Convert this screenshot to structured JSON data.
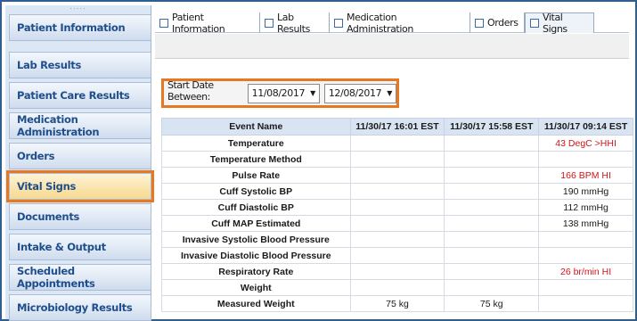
{
  "sidebar": {
    "items": [
      {
        "label": "Patient Information",
        "active": false
      },
      {
        "label": "Lab Results",
        "active": false
      },
      {
        "label": "Patient Care Results",
        "active": false
      },
      {
        "label": "Medication Administration",
        "active": false
      },
      {
        "label": "Orders",
        "active": false
      },
      {
        "label": "Vital Signs",
        "active": true
      },
      {
        "label": "Documents",
        "active": false
      },
      {
        "label": "Intake & Output",
        "active": false
      },
      {
        "label": "Scheduled Appointments",
        "active": false
      },
      {
        "label": "Microbiology Results",
        "active": false
      }
    ]
  },
  "tabs": [
    {
      "label": "Patient Information",
      "icon": "page-icon"
    },
    {
      "label": "Lab Results",
      "icon": "page-icon"
    },
    {
      "label": "Medication Administration",
      "icon": "page-icon"
    },
    {
      "label": "Orders",
      "icon": "page-icon"
    },
    {
      "label": "Vital Signs",
      "icon": "page-icon",
      "active": true
    }
  ],
  "filter": {
    "label": "Start Date Between:",
    "start": "11/08/2017",
    "end": "12/08/2017"
  },
  "grid": {
    "headers": [
      "Event Name",
      "11/30/17 16:01 EST",
      "11/30/17 15:58 EST",
      "11/30/17 09:14 EST"
    ],
    "rows": [
      {
        "name": "Temperature",
        "v1": "",
        "v2": "",
        "v3": "43 DegC >HHI",
        "abnormal": true
      },
      {
        "name": "Temperature Method",
        "v1": "",
        "v2": "",
        "v3": "",
        "abnormal": false
      },
      {
        "name": "Pulse Rate",
        "v1": "",
        "v2": "",
        "v3": "166 BPM HI",
        "abnormal": true
      },
      {
        "name": "Cuff Systolic BP",
        "v1": "",
        "v2": "",
        "v3": "190 mmHg",
        "abnormal": false
      },
      {
        "name": "Cuff Diastolic BP",
        "v1": "",
        "v2": "",
        "v3": "112 mmHg",
        "abnormal": false
      },
      {
        "name": "Cuff MAP Estimated",
        "v1": "",
        "v2": "",
        "v3": "138 mmHg",
        "abnormal": false
      },
      {
        "name": "Invasive Systolic Blood Pressure",
        "v1": "",
        "v2": "",
        "v3": "",
        "abnormal": false
      },
      {
        "name": "Invasive Diastolic Blood Pressure",
        "v1": "",
        "v2": "",
        "v3": "",
        "abnormal": false
      },
      {
        "name": "Respiratory Rate",
        "v1": "",
        "v2": "",
        "v3": "26 br/min HI",
        "abnormal": true
      },
      {
        "name": "Weight",
        "v1": "",
        "v2": "",
        "v3": "",
        "abnormal": false
      },
      {
        "name": "Measured Weight",
        "v1": "75 kg",
        "v2": "75 kg",
        "v3": "",
        "abnormal": false
      }
    ]
  },
  "colors": {
    "highlight": "#e87722",
    "nav_text": "#1f4e8c",
    "abnormal": "#d0141a"
  }
}
